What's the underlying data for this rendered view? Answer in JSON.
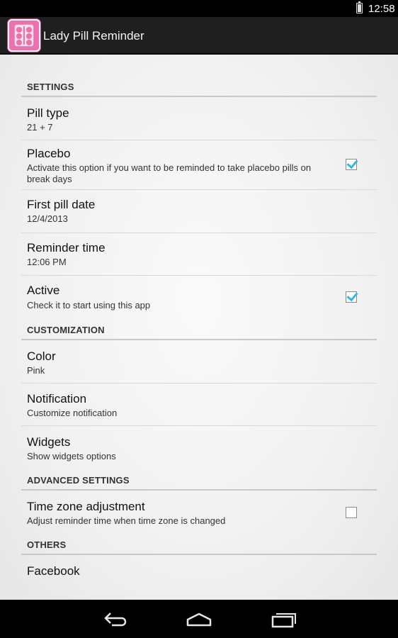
{
  "status_bar": {
    "time": "12:58",
    "battery_level": 0.85
  },
  "action_bar": {
    "title": "Lady Pill Reminder",
    "app_icon": "pill-pack-icon"
  },
  "categories": {
    "settings": "SETTINGS",
    "customization": "CUSTOMIZATION",
    "advanced": "ADVANCED SETTINGS",
    "others": "OTHERS"
  },
  "prefs": {
    "pill_type": {
      "title": "Pill type",
      "summary": "21 + 7"
    },
    "placebo": {
      "title": "Placebo",
      "summary": "Activate this option if you want to be reminded to take placebo pills on break days",
      "checked": true
    },
    "first_pill_date": {
      "title": "First pill date",
      "summary": "12/4/2013"
    },
    "reminder_time": {
      "title": "Reminder time",
      "summary": "12:06 PM"
    },
    "active": {
      "title": "Active",
      "summary": "Check it to start using this app",
      "checked": true
    },
    "color": {
      "title": "Color",
      "summary": "Pink"
    },
    "notification": {
      "title": "Notification",
      "summary": "Customize notification"
    },
    "widgets": {
      "title": "Widgets",
      "summary": "Show widgets options"
    },
    "time_zone": {
      "title": "Time zone adjustment",
      "summary": "Adjust reminder time when time zone is changed",
      "checked": false
    },
    "facebook": {
      "title": "Facebook"
    }
  },
  "nav_bar": {
    "back": "back-icon",
    "home": "home-icon",
    "recents": "recent-apps-icon"
  },
  "colors": {
    "accent": "#33b5e5",
    "action_bar": "#1f1f1f",
    "icon_pink": "#f06fae"
  }
}
